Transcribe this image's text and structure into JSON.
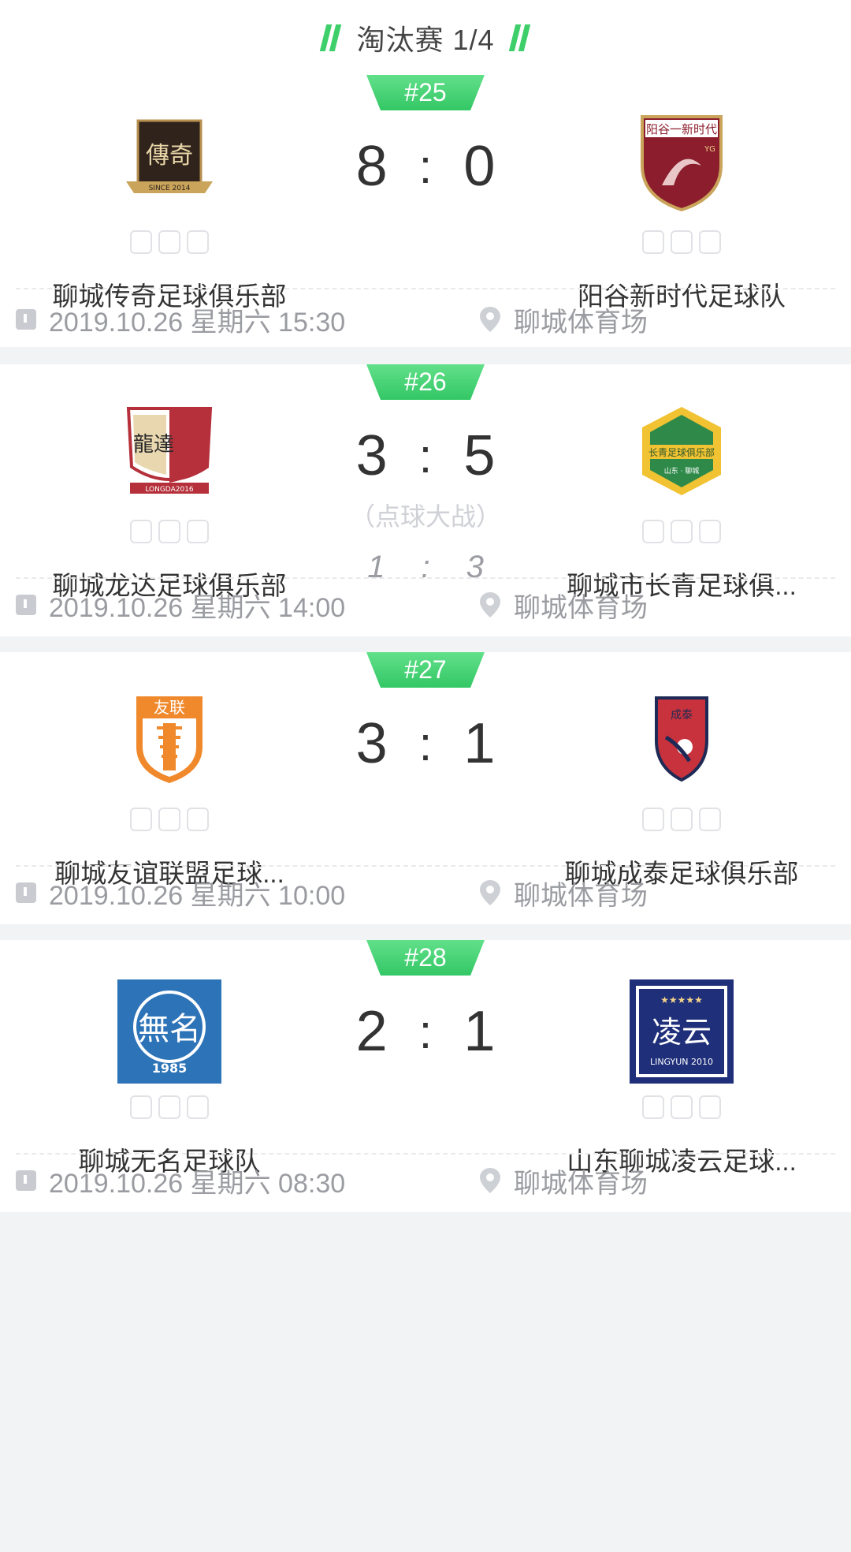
{
  "round": {
    "title": "淘汰赛 1/4"
  },
  "matches": [
    {
      "number": "#25",
      "home": {
        "name": "聊城传奇足球俱乐部",
        "logo_text": "傳奇",
        "logo_sub": "SINCE 2014"
      },
      "away": {
        "name": "阳谷新时代足球队",
        "logo_text": "阳谷一新时代",
        "logo_sub": "YG"
      },
      "score_home": "8",
      "score_away": "0",
      "colon": ":",
      "penalty": null,
      "datetime": "2019.10.26 星期六 15:30",
      "venue": "聊城体育场"
    },
    {
      "number": "#26",
      "home": {
        "name": "聊城龙达足球俱乐部",
        "logo_text": "龍達",
        "logo_sub": "LONGDA2016"
      },
      "away": {
        "name": "聊城市长青足球俱...",
        "logo_text": "长青足球俱乐部",
        "logo_sub": "山东 · 聊城"
      },
      "score_home": "3",
      "score_away": "5",
      "colon": ":",
      "penalty": {
        "label": "（点球大战）",
        "home": "1",
        "away": "3"
      },
      "datetime": "2019.10.26 星期六 14:00",
      "venue": "聊城体育场"
    },
    {
      "number": "#27",
      "home": {
        "name": "聊城友谊联盟足球...",
        "logo_text": "友联",
        "logo_sub": ""
      },
      "away": {
        "name": "聊城成泰足球俱乐部",
        "logo_text": "成泰",
        "logo_sub": ""
      },
      "score_home": "3",
      "score_away": "1",
      "colon": ":",
      "penalty": null,
      "datetime": "2019.10.26 星期六 10:00",
      "venue": "聊城体育场"
    },
    {
      "number": "#28",
      "home": {
        "name": "聊城无名足球队",
        "logo_text": "無名",
        "logo_sub": "1985"
      },
      "away": {
        "name": "山东聊城凌云足球...",
        "logo_text": "凌云",
        "logo_sub": "LINGYUN 2010"
      },
      "score_home": "2",
      "score_away": "1",
      "colon": ":",
      "penalty": null,
      "datetime": "2019.10.26 星期六 08:30",
      "venue": "聊城体育场"
    }
  ],
  "colors": {
    "accent": "#3ecf6a",
    "muted": "#9a9ca1"
  },
  "icons": {
    "time": "clock-icon",
    "venue": "location-pin-icon",
    "round": "double-slash-icon"
  }
}
